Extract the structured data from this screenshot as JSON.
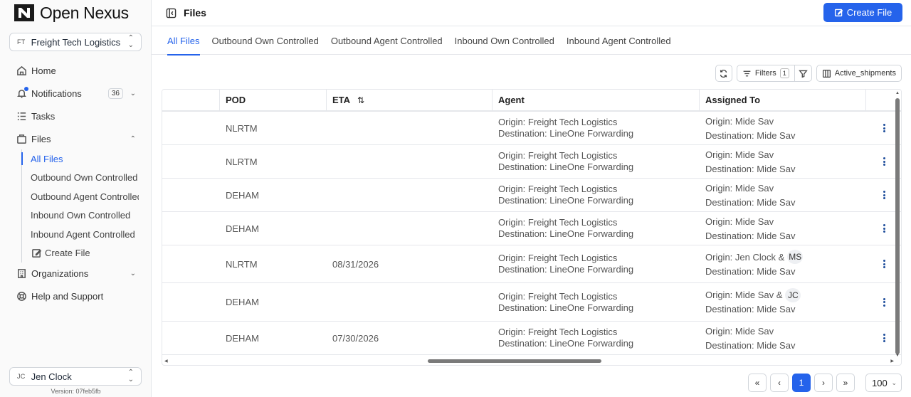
{
  "app": {
    "brand": "Open Nexus",
    "version": "Version: 07feb5fb"
  },
  "org": {
    "initials": "FT",
    "name": "Freight Tech Logistics"
  },
  "user": {
    "initials": "JC",
    "name": "Jen Clock"
  },
  "nav": {
    "home": "Home",
    "notifications": "Notifications",
    "notifications_count": "36",
    "tasks": "Tasks",
    "files": "Files",
    "files_sub": [
      "All Files",
      "Outbound Own Controlled",
      "Outbound Agent Controlled",
      "Inbound Own Controlled",
      "Inbound Agent Controlled"
    ],
    "create_file": "Create File",
    "organizations": "Organizations",
    "help": "Help and Support"
  },
  "header": {
    "title": "Files",
    "create_button": "Create File"
  },
  "tabs": [
    "All Files",
    "Outbound Own Controlled",
    "Outbound Agent Controlled",
    "Inbound Own Controlled",
    "Inbound Agent Controlled"
  ],
  "toolbar": {
    "filters_label": "Filters",
    "filters_count": "1",
    "view_label": "Active_shipments"
  },
  "table": {
    "columns": [
      "",
      "POD",
      "ETA",
      "Agent",
      "Assigned To",
      ""
    ],
    "rows": [
      {
        "pod": "NLRTM",
        "eta": "",
        "agent_origin": "Origin: Freight Tech Logistics",
        "agent_dest": "Destination: LineOne Forwarding",
        "assigned_origin": "Origin: Mide Sav",
        "assigned_extra": "",
        "assigned_dest": "Destination: Mide Sav"
      },
      {
        "pod": "NLRTM",
        "eta": "",
        "agent_origin": "Origin: Freight Tech Logistics",
        "agent_dest": "Destination: LineOne Forwarding",
        "assigned_origin": "Origin: Mide Sav",
        "assigned_extra": "",
        "assigned_dest": "Destination: Mide Sav"
      },
      {
        "pod": "DEHAM",
        "eta": "",
        "agent_origin": "Origin: Freight Tech Logistics",
        "agent_dest": "Destination: LineOne Forwarding",
        "assigned_origin": "Origin: Mide Sav",
        "assigned_extra": "",
        "assigned_dest": "Destination: Mide Sav"
      },
      {
        "pod": "DEHAM",
        "eta": "",
        "agent_origin": "Origin: Freight Tech Logistics",
        "agent_dest": "Destination: LineOne Forwarding",
        "assigned_origin": "Origin: Mide Sav",
        "assigned_extra": "",
        "assigned_dest": "Destination: Mide Sav"
      },
      {
        "pod": "NLRTM",
        "eta": "08/31/2026",
        "agent_origin": "Origin: Freight Tech Logistics",
        "agent_dest": "Destination: LineOne Forwarding",
        "assigned_origin": "Origin: Jen Clock &",
        "assigned_extra": "MS",
        "assigned_dest": "Destination: Mide Sav"
      },
      {
        "pod": "DEHAM",
        "eta": "",
        "agent_origin": "Origin: Freight Tech Logistics",
        "agent_dest": "Destination: LineOne Forwarding",
        "assigned_origin": "Origin: Mide Sav &",
        "assigned_extra": "JC",
        "assigned_dest": "Destination: Mide Sav"
      },
      {
        "pod": "DEHAM",
        "eta": "07/30/2026",
        "agent_origin": "Origin: Freight Tech Logistics",
        "agent_dest": "Destination: LineOne Forwarding",
        "assigned_origin": "Origin: Mide Sav",
        "assigned_extra": "",
        "assigned_dest": "Destination: Mide Sav"
      }
    ]
  },
  "pagination": {
    "current_page": "1",
    "page_size": "100"
  },
  "colors": {
    "accent": "#2563eb",
    "border": "#e5e7eb"
  }
}
